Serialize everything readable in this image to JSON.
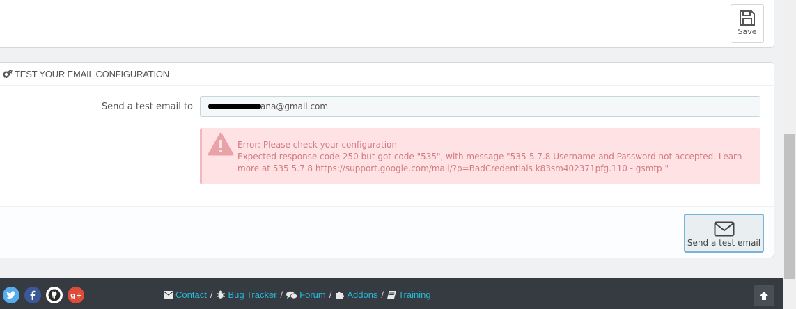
{
  "toolbar": {
    "save_label": "Save"
  },
  "test_panel": {
    "heading": "TEST YOUR EMAIL CONFIGURATION",
    "send_label": "Send a test email to",
    "email_visible_suffix": "ana@gmail.com",
    "error_title": "Error: Please check your configuration",
    "error_message": "Expected response code 250 but got code \"535\", with message \"535-5.7.8 Username and Password not accepted. Learn more at 535 5.7.8 https://support.google.com/mail/?p=BadCredentials k83sm402371pfg.110 - gsmtp \"",
    "send_button_label": "Send a test email"
  },
  "footer": {
    "social": [
      "twitter-icon",
      "facebook-icon",
      "github-icon",
      "google-plus-icon"
    ],
    "links": [
      {
        "label": "Contact",
        "icon": "envelope-icon"
      },
      {
        "label": "Bug Tracker",
        "icon": "bug-icon"
      },
      {
        "label": "Forum",
        "icon": "comments-icon"
      },
      {
        "label": "Addons",
        "icon": "puzzle-icon"
      },
      {
        "label": "Training",
        "icon": "book-icon"
      }
    ],
    "separator": "/"
  },
  "colors": {
    "link": "#25b9d7",
    "error_bg": "#ffe2e4",
    "error_text": "#d27c82",
    "footer_bg": "#363a41"
  }
}
